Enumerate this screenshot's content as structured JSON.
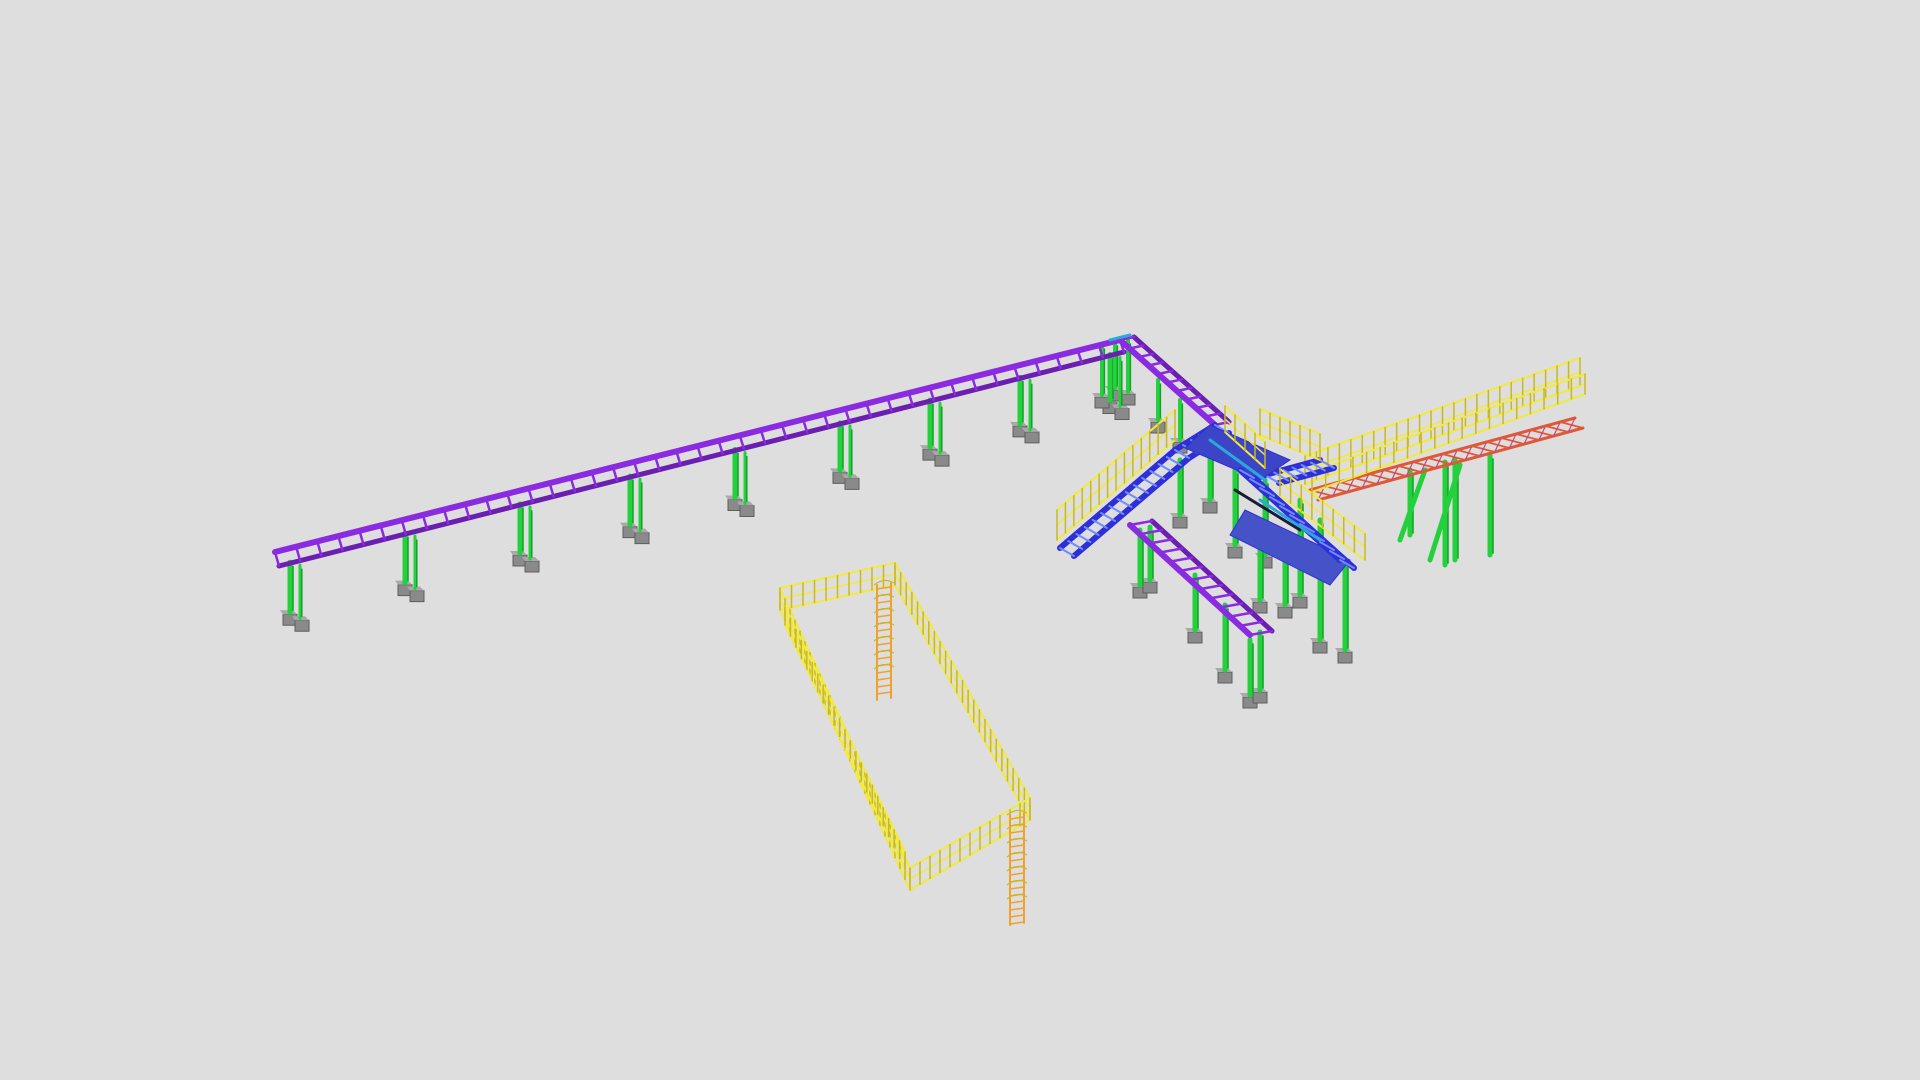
{
  "viewer": {
    "background": "#dedede"
  },
  "palette": {
    "pipe_rack_beam": "#8a2be2",
    "pipe_rack_beam_dark": "#6a1fb0",
    "column": "#22d13c",
    "column_dark": "#15a02a",
    "footing": "#8a8a8a",
    "footing_dark": "#5e5e5e",
    "handrail": "#f2ea3c",
    "handrail_dark": "#c9b820",
    "stair": "#2f2fd8",
    "stair_light": "#6f8cff",
    "ladder": "#f0a030",
    "truss": "#e0583a",
    "bracing": "#2aa8d8"
  },
  "scene_objects": [
    {
      "name": "main-pipe-rack"
    },
    {
      "name": "rack-columns"
    },
    {
      "name": "column-footings"
    },
    {
      "name": "handrail-platform"
    },
    {
      "name": "access-ladders"
    },
    {
      "name": "stair-tower"
    },
    {
      "name": "branch-rack"
    },
    {
      "name": "truss-walkway"
    },
    {
      "name": "walkway-columns"
    }
  ]
}
